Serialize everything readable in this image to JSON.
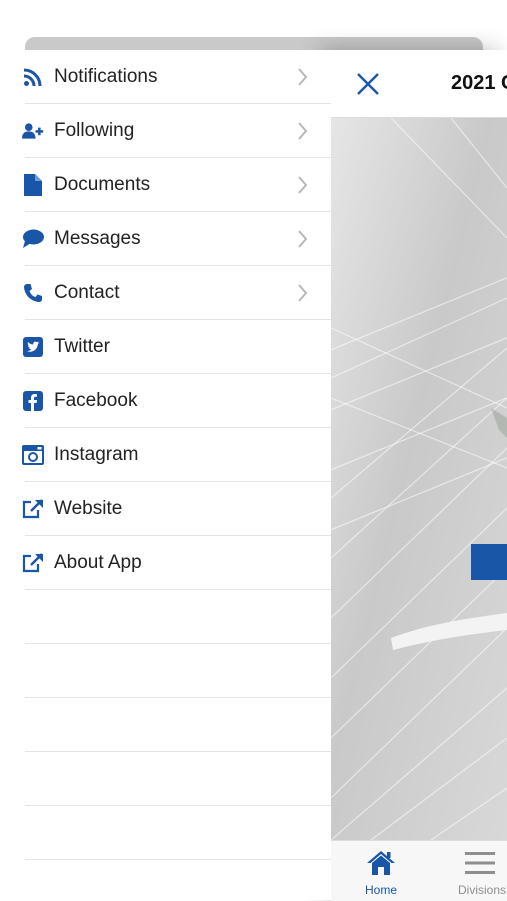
{
  "menu": {
    "items": [
      {
        "label": "Notifications",
        "icon": "rss-icon",
        "chevron": true
      },
      {
        "label": "Following",
        "icon": "user-plus-icon",
        "chevron": true
      },
      {
        "label": "Documents",
        "icon": "document-icon",
        "chevron": true
      },
      {
        "label": "Messages",
        "icon": "speech-bubble-icon",
        "chevron": true
      },
      {
        "label": "Contact",
        "icon": "phone-icon",
        "chevron": true
      },
      {
        "label": "Twitter",
        "icon": "twitter-icon",
        "chevron": false
      },
      {
        "label": "Facebook",
        "icon": "facebook-icon",
        "chevron": false
      },
      {
        "label": "Instagram",
        "icon": "instagram-icon",
        "chevron": false
      },
      {
        "label": "Website",
        "icon": "external-link-icon",
        "chevron": false
      },
      {
        "label": "About App",
        "icon": "external-link-icon",
        "chevron": false
      }
    ]
  },
  "header": {
    "title": "2021 C"
  },
  "tabbar": {
    "tabs": [
      {
        "label": "Home",
        "icon": "home-icon",
        "active": true
      },
      {
        "label": "Divisions",
        "icon": "menu-lines-icon",
        "active": false
      }
    ]
  },
  "colors": {
    "brand_blue": "#1a56a8",
    "text": "#222222",
    "separator": "#e4e4e4",
    "tab_inactive": "#8e8e8e"
  }
}
